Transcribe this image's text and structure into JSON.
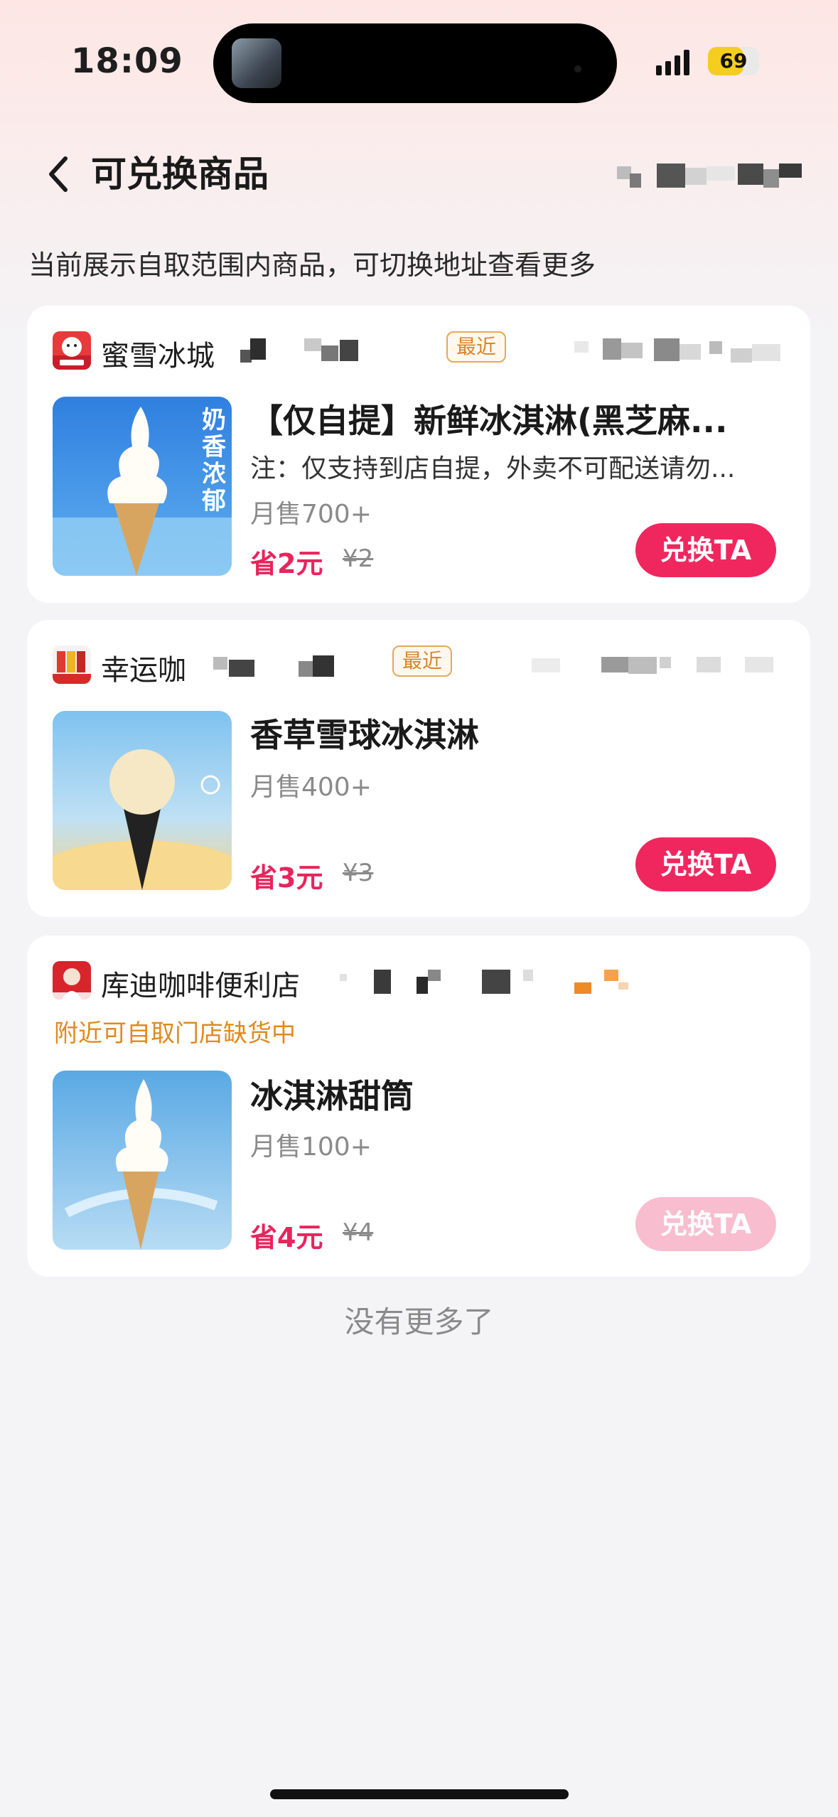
{
  "status_bar": {
    "time": "18:09",
    "battery": "69",
    "battery_level": 0.69
  },
  "header": {
    "title": "可兑换商品"
  },
  "subtitle": "当前展示自取范围内商品，可切换地址查看更多",
  "colors": {
    "accent": "#f0275e",
    "save_text": "#e8245c",
    "notice": "#e08a1e",
    "tag": "#d9872b"
  },
  "cards": [
    {
      "store": "蜜雪冰城",
      "tag": "最近",
      "product_title": "【仅自提】新鲜冰淇淋(黑芝麻...",
      "note": "注：仅支持到店自提，外卖不可配送请勿...",
      "image_text": "奶香浓郁",
      "sales": "月售700+",
      "save": "省2元",
      "original_price": "¥2",
      "button": "兑换TA"
    },
    {
      "store": "幸运咖",
      "tag": "最近",
      "product_title": "香草雪球冰淇淋",
      "sales": "月售400+",
      "save": "省3元",
      "original_price": "¥3",
      "button": "兑换TA"
    },
    {
      "store": "库迪咖啡便利店",
      "notice": "附近可自取门店缺货中",
      "product_title": "冰淇淋甜筒",
      "sales": "月售100+",
      "save": "省4元",
      "original_price": "¥4",
      "button": "兑换TA"
    }
  ],
  "footer": "没有更多了"
}
